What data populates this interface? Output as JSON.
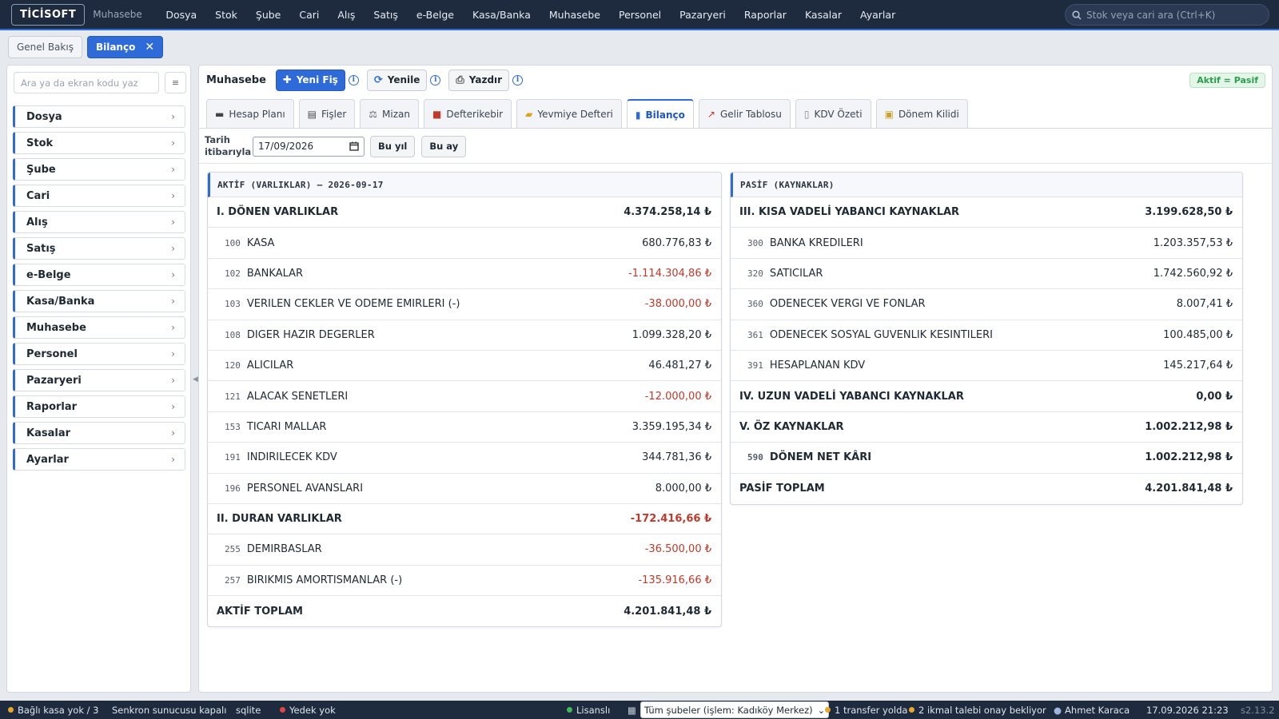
{
  "topbar": {
    "logo": "TİCİSOFT",
    "module": "Muhasebe",
    "nav": [
      "Dosya",
      "Stok",
      "Şube",
      "Cari",
      "Alış",
      "Satış",
      "e-Belge",
      "Kasa/Banka",
      "Muhasebe",
      "Personel",
      "Pazaryeri",
      "Raporlar",
      "Kasalar",
      "Ayarlar"
    ],
    "search_placeholder": "Stok veya cari ara (Ctrl+K)"
  },
  "page_tabs": {
    "overview": "Genel Bakış",
    "active": "Bilanço",
    "close": "✕"
  },
  "sidebar": {
    "search_placeholder": "Ara ya da ekran kodu yaz",
    "items": [
      "Dosya",
      "Stok",
      "Şube",
      "Cari",
      "Alış",
      "Satış",
      "e-Belge",
      "Kasa/Banka",
      "Muhasebe",
      "Personel",
      "Pazaryeri",
      "Raporlar",
      "Kasalar",
      "Ayarlar"
    ]
  },
  "toolbar": {
    "title": "Muhasebe",
    "new_voucher": "Yeni Fiş",
    "refresh": "Yenile",
    "print": "Yazdır",
    "badge": "Aktif = Pasif"
  },
  "subtabs": [
    "Hesap Planı",
    "Fişler",
    "Mizan",
    "Defterikebir",
    "Yevmiye Defteri",
    "Bilanço",
    "Gelir Tablosu",
    "KDV Özeti",
    "Dönem Kilidi"
  ],
  "subtab_icons": [
    "book-icon",
    "voucher-icon",
    "scale-icon",
    "ledger-icon",
    "journal-icon",
    "bar-chart-icon",
    "line-chart-icon",
    "tax-icon",
    "lock-icon"
  ],
  "filter": {
    "label_line1": "Tarih",
    "label_line2": "itibarıyla",
    "date": "17/09/2026",
    "this_year": "Bu yıl",
    "this_month": "Bu ay"
  },
  "assets": {
    "header": "AKTİF (VARLIKLAR) — 2026-09-17",
    "rows": [
      {
        "type": "section",
        "code": "",
        "label": "I. DÖNEN VARLIKLAR",
        "amount": "4.374.258,14 ₺",
        "negative": false
      },
      {
        "type": "item",
        "code": "100",
        "label": "KASA",
        "amount": "680.776,83 ₺",
        "negative": false
      },
      {
        "type": "item",
        "code": "102",
        "label": "BANKALAR",
        "amount": "-1.114.304,86 ₺",
        "negative": true
      },
      {
        "type": "item",
        "code": "103",
        "label": "VERILEN CEKLER VE ODEME EMIRLERI (-)",
        "amount": "-38.000,00 ₺",
        "negative": true
      },
      {
        "type": "item",
        "code": "108",
        "label": "DIGER HAZIR DEGERLER",
        "amount": "1.099.328,20 ₺",
        "negative": false
      },
      {
        "type": "item",
        "code": "120",
        "label": "ALICILAR",
        "amount": "46.481,27 ₺",
        "negative": false
      },
      {
        "type": "item",
        "code": "121",
        "label": "ALACAK SENETLERI",
        "amount": "-12.000,00 ₺",
        "negative": true
      },
      {
        "type": "item",
        "code": "153",
        "label": "TICARI MALLAR",
        "amount": "3.359.195,34 ₺",
        "negative": false
      },
      {
        "type": "item",
        "code": "191",
        "label": "INDIRILECEK KDV",
        "amount": "344.781,36 ₺",
        "negative": false
      },
      {
        "type": "item",
        "code": "196",
        "label": "PERSONEL AVANSLARI",
        "amount": "8.000,00 ₺",
        "negative": false
      },
      {
        "type": "section",
        "code": "",
        "label": "II. DURAN VARLIKLAR",
        "amount": "-172.416,66 ₺",
        "negative": true
      },
      {
        "type": "item",
        "code": "255",
        "label": "DEMIRBASLAR",
        "amount": "-36.500,00 ₺",
        "negative": true
      },
      {
        "type": "item",
        "code": "257",
        "label": "BIRIKMIS AMORTISMANLAR (-)",
        "amount": "-135.916,66 ₺",
        "negative": true
      },
      {
        "type": "total",
        "code": "",
        "label": "AKTİF TOPLAM",
        "amount": "4.201.841,48 ₺",
        "negative": false
      }
    ]
  },
  "liabilities": {
    "header": "PASİF (KAYNAKLAR)",
    "rows": [
      {
        "type": "section",
        "code": "",
        "label": "III. KISA VADELİ YABANCI KAYNAKLAR",
        "amount": "3.199.628,50 ₺",
        "negative": false
      },
      {
        "type": "item",
        "code": "300",
        "label": "BANKA KREDILERI",
        "amount": "1.203.357,53 ₺",
        "negative": false
      },
      {
        "type": "item",
        "code": "320",
        "label": "SATICILAR",
        "amount": "1.742.560,92 ₺",
        "negative": false
      },
      {
        "type": "item",
        "code": "360",
        "label": "ODENECEK VERGI VE FONLAR",
        "amount": "8.007,41 ₺",
        "negative": false
      },
      {
        "type": "item",
        "code": "361",
        "label": "ODENECEK SOSYAL GUVENLIK KESINTILERI",
        "amount": "100.485,00 ₺",
        "negative": false
      },
      {
        "type": "item",
        "code": "391",
        "label": "HESAPLANAN KDV",
        "amount": "145.217,64 ₺",
        "negative": false
      },
      {
        "type": "section",
        "code": "",
        "label": "IV. UZUN VADELİ YABANCI KAYNAKLAR",
        "amount": "0,00 ₺",
        "negative": false
      },
      {
        "type": "section",
        "code": "",
        "label": "V. ÖZ KAYNAKLAR",
        "amount": "1.002.212,98 ₺",
        "negative": false
      },
      {
        "type": "item-strong",
        "code": "590",
        "label": "DÖNEM NET KÂRI",
        "amount": "1.002.212,98 ₺",
        "negative": false
      },
      {
        "type": "total",
        "code": "",
        "label": "PASİF TOPLAM",
        "amount": "4.201.841,48 ₺",
        "negative": false
      }
    ]
  },
  "statusbar": {
    "cash_registers": "Bağlı kasa yok / 3",
    "sync": "Senkron sunucusu kapalı",
    "db": "sqlite",
    "backup": "Yedek yok",
    "license": "Lisanslı",
    "branch_select": "Tüm şubeler (işlem: Kadıköy Merkez)",
    "transfers": "1 transfer yolda",
    "requests": "2 ikmal talebi onay bekliyor",
    "user": "Ahmet Karaca",
    "datetime": "17.09.2026 21:23",
    "version": "s2.13.2"
  },
  "colors": {
    "accent": "#2f6bd8",
    "topbar": "#1e2b3f",
    "negative": "#c0392b",
    "success": "#2e9e4e"
  }
}
